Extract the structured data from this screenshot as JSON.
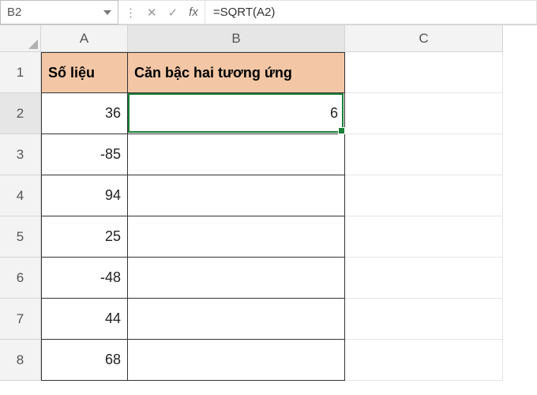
{
  "formula_bar": {
    "name_box": "B2",
    "cancel": "✕",
    "enter": "✓",
    "fx": "fx",
    "dots": "⋮",
    "formula": "=SQRT(A2)"
  },
  "columns": [
    "A",
    "B",
    "C"
  ],
  "rows": [
    "1",
    "2",
    "3",
    "4",
    "5",
    "6",
    "7",
    "8"
  ],
  "headers": {
    "A": "Số liệu",
    "B": "Căn bậc hai tương ứng"
  },
  "data": {
    "A": [
      "36",
      "-85",
      "94",
      "25",
      "-48",
      "44",
      "68"
    ],
    "B": [
      "6",
      "",
      "",
      "",
      "",
      "",
      ""
    ]
  },
  "selection": {
    "cell": "B2"
  }
}
